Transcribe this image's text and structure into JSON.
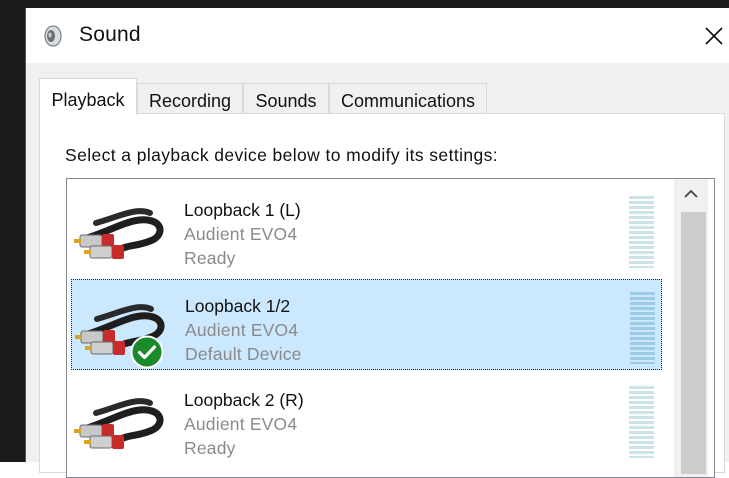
{
  "window": {
    "title": "Sound",
    "app_icon": "speaker-icon",
    "close_icon": "close-icon"
  },
  "tabs": [
    {
      "label": "Playback",
      "active": true
    },
    {
      "label": "Recording",
      "active": false
    },
    {
      "label": "Sounds",
      "active": false
    },
    {
      "label": "Communications",
      "active": false
    }
  ],
  "playback": {
    "instruction": "Select a playback device below to modify its settings:",
    "devices": [
      {
        "name": "Loopback 1 (L)",
        "driver": "Audient EVO4",
        "status": "Ready",
        "selected": false,
        "is_default": false,
        "icon": "rca-cable-icon"
      },
      {
        "name": "Loopback 1/2",
        "driver": "Audient EVO4",
        "status": "Default Device",
        "selected": true,
        "is_default": true,
        "icon": "rca-cable-icon"
      },
      {
        "name": "Loopback 2 (R)",
        "driver": "Audient EVO4",
        "status": "Ready",
        "selected": false,
        "is_default": false,
        "icon": "rca-cable-icon"
      }
    ]
  },
  "colors": {
    "selection": "#cce8ff",
    "default_check": "#107c10",
    "meter": "#cde3ea"
  }
}
